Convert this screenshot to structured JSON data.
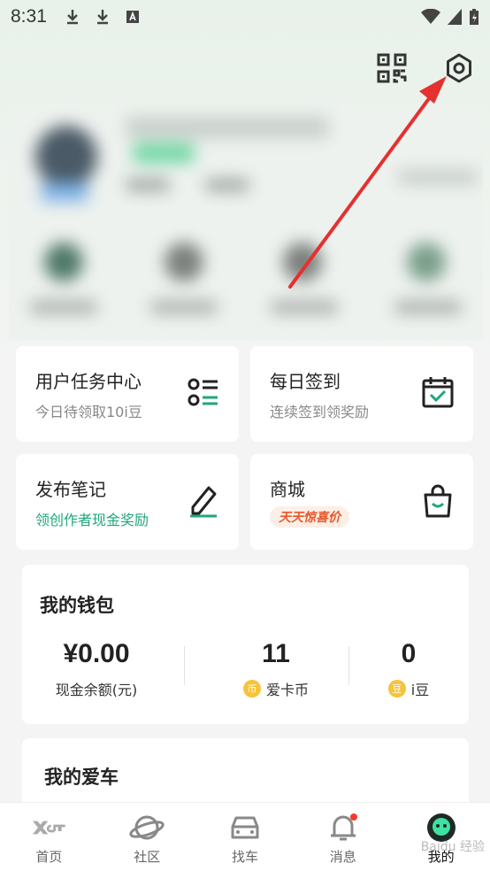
{
  "status_bar": {
    "time": "8:31"
  },
  "tasks": {
    "user_task": {
      "title": "用户任务中心",
      "subtitle": "今日待领取10i豆"
    },
    "daily_checkin": {
      "title": "每日签到",
      "subtitle": "连续签到领奖励"
    },
    "publish_note": {
      "title": "发布笔记",
      "subtitle": "领创作者现金奖励"
    },
    "mall": {
      "title": "商城",
      "promo": "天天惊喜价"
    }
  },
  "wallet": {
    "title": "我的钱包",
    "cash": {
      "value": "¥0.00",
      "label": "现金余额(元)"
    },
    "aika_coin": {
      "value": "11",
      "label": "爱卡币",
      "coin_glyph": "币"
    },
    "idou": {
      "value": "0",
      "label": "i豆",
      "coin_glyph": "豆"
    }
  },
  "my_car": {
    "title": "我的爱车"
  },
  "tab_bar": {
    "items": [
      {
        "label": "首页",
        "icon": "xcar-logo-icon"
      },
      {
        "label": "社区",
        "icon": "planet-icon"
      },
      {
        "label": "找车",
        "icon": "car-icon"
      },
      {
        "label": "消息",
        "icon": "bell-icon"
      },
      {
        "label": "我的",
        "icon": "avatar-icon"
      }
    ],
    "active_index": 4
  },
  "colors": {
    "accent_green": "#1fa77a",
    "promo_orange": "#e8572a",
    "annotation_red": "#e53030",
    "coin_gold": "#f6c33a"
  },
  "watermark": "Baidu 经验"
}
